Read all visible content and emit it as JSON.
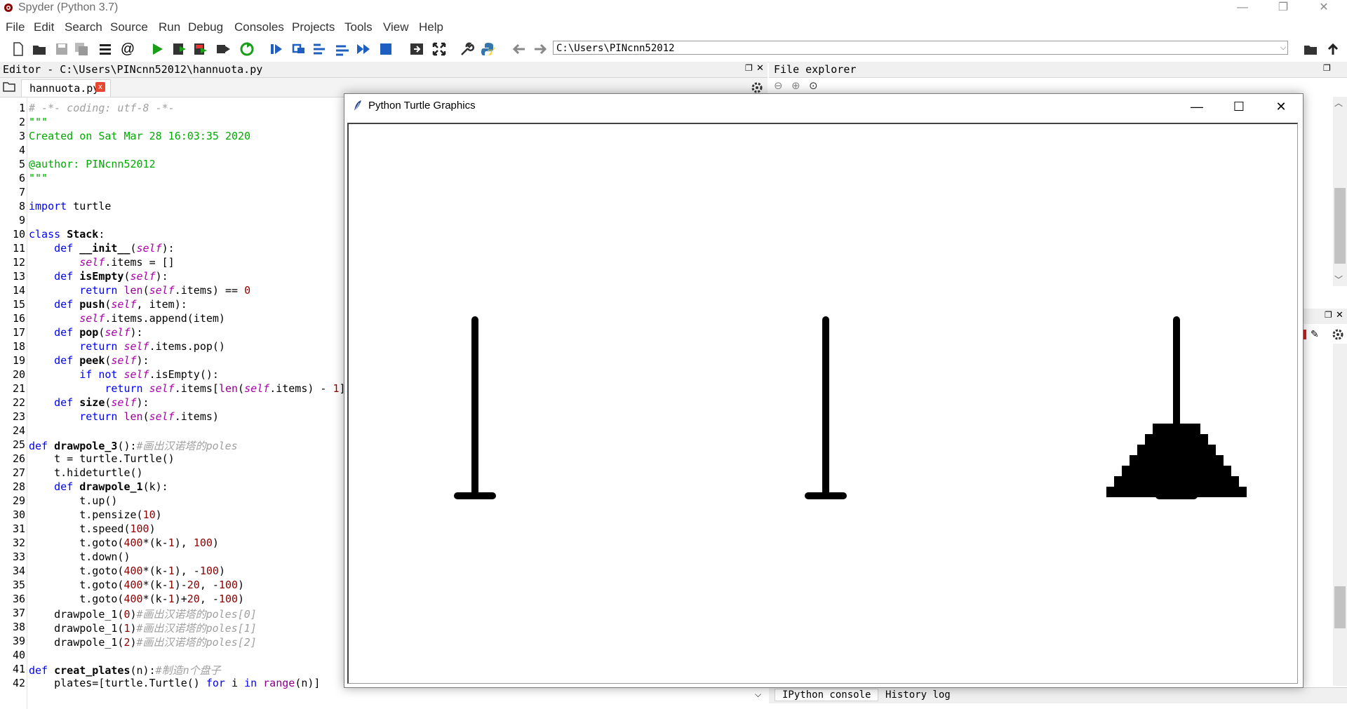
{
  "app": {
    "title": "Spyder (Python 3.7)"
  },
  "window_controls": {
    "minimize": "—",
    "restore": "❐",
    "close": "✕"
  },
  "menu": [
    "File",
    "Edit",
    "Search",
    "Source",
    "Run",
    "Debug",
    "Consoles",
    "Projects",
    "Tools",
    "View",
    "Help"
  ],
  "toolbar": {
    "path": "C:\\Users\\PINcnn52012"
  },
  "editor": {
    "header": "Editor - C:\\Users\\PINcnn52012\\hannuota.py",
    "tab_label": "hannuota.py",
    "tab_close": "x"
  },
  "code_lines": [
    {
      "n": "1",
      "html": "<span class='cm'># -*- coding: utf-8 -*-</span>"
    },
    {
      "n": "2",
      "html": "<span class='st'>\"\"\"</span>"
    },
    {
      "n": "3",
      "html": "<span class='st'>Created on Sat Mar 28 16:03:35 2020</span>"
    },
    {
      "n": "4",
      "html": ""
    },
    {
      "n": "5",
      "html": "<span class='st'>@author: PINcnn52012</span>"
    },
    {
      "n": "6",
      "html": "<span class='st'>\"\"\"</span>"
    },
    {
      "n": "7",
      "html": ""
    },
    {
      "n": "8",
      "html": "<span class='kw'>import</span> turtle"
    },
    {
      "n": "9",
      "html": ""
    },
    {
      "n": "10",
      "html": "<span class='kw'>class</span> <span class='fn'>Stack</span>:"
    },
    {
      "n": "11",
      "html": "    <span class='kw'>def</span> <span class='fn'>__init__</span>(<span class='sf'>self</span>):"
    },
    {
      "n": "12",
      "html": "        <span class='sf'>self</span>.items = []"
    },
    {
      "n": "13",
      "html": "    <span class='kw'>def</span> <span class='fn'>isEmpty</span>(<span class='sf'>self</span>):"
    },
    {
      "n": "14",
      "html": "        <span class='kw'>return</span> <span class='bi'>len</span>(<span class='sf'>self</span>.items) == <span class='nm'>0</span>"
    },
    {
      "n": "15",
      "html": "    <span class='kw'>def</span> <span class='fn'>push</span>(<span class='sf'>self</span>, item):"
    },
    {
      "n": "16",
      "html": "        <span class='sf'>self</span>.items.append(item)"
    },
    {
      "n": "17",
      "html": "    <span class='kw'>def</span> <span class='fn'>pop</span>(<span class='sf'>self</span>):"
    },
    {
      "n": "18",
      "html": "        <span class='kw'>return</span> <span class='sf'>self</span>.items.pop()"
    },
    {
      "n": "19",
      "html": "    <span class='kw'>def</span> <span class='fn'>peek</span>(<span class='sf'>self</span>):"
    },
    {
      "n": "20",
      "html": "        <span class='kw'>if not</span> <span class='sf'>self</span>.isEmpty():"
    },
    {
      "n": "21",
      "html": "            <span class='kw'>return</span> <span class='sf'>self</span>.items[<span class='bi'>len</span>(<span class='sf'>self</span>.items) - <span class='nm'>1</span>]"
    },
    {
      "n": "22",
      "html": "    <span class='kw'>def</span> <span class='fn'>size</span>(<span class='sf'>self</span>):"
    },
    {
      "n": "23",
      "html": "        <span class='kw'>return</span> <span class='bi'>len</span>(<span class='sf'>self</span>.items)"
    },
    {
      "n": "24",
      "html": ""
    },
    {
      "n": "25",
      "html": "<span class='kw'>def</span> <span class='fn'>drawpole_3</span>():<span class='cm'>#画出汉诺塔的poles</span>"
    },
    {
      "n": "26",
      "html": "    t = turtle.Turtle()"
    },
    {
      "n": "27",
      "html": "    t.hideturtle()"
    },
    {
      "n": "28",
      "html": "    <span class='kw'>def</span> <span class='fn'>drawpole_1</span>(k):"
    },
    {
      "n": "29",
      "html": "        t.up()"
    },
    {
      "n": "30",
      "html": "        t.pensize(<span class='nm'>10</span>)"
    },
    {
      "n": "31",
      "html": "        t.speed(<span class='nm'>100</span>)"
    },
    {
      "n": "32",
      "html": "        t.goto(<span class='nm'>400</span>*(k-<span class='nm'>1</span>), <span class='nm'>100</span>)"
    },
    {
      "n": "33",
      "html": "        t.down()"
    },
    {
      "n": "34",
      "html": "        t.goto(<span class='nm'>400</span>*(k-<span class='nm'>1</span>), -<span class='nm'>100</span>)"
    },
    {
      "n": "35",
      "html": "        t.goto(<span class='nm'>400</span>*(k-<span class='nm'>1</span>)-<span class='nm'>20</span>, -<span class='nm'>100</span>)"
    },
    {
      "n": "36",
      "html": "        t.goto(<span class='nm'>400</span>*(k-<span class='nm'>1</span>)+<span class='nm'>20</span>, -<span class='nm'>100</span>)"
    },
    {
      "n": "37",
      "html": "    drawpole_1(<span class='nm'>0</span>)<span class='cm'>#画出汉诺塔的poles[0]</span>"
    },
    {
      "n": "38",
      "html": "    drawpole_1(<span class='nm'>1</span>)<span class='cm'>#画出汉诺塔的poles[1]</span>"
    },
    {
      "n": "39",
      "html": "    drawpole_1(<span class='nm'>2</span>)<span class='cm'>#画出汉诺塔的poles[2]</span>"
    },
    {
      "n": "40",
      "html": ""
    },
    {
      "n": "41",
      "html": "<span class='kw'>def</span> <span class='fn'>creat_plates</span>(n):<span class='cm'>#制造n个盘子</span>"
    },
    {
      "n": "42",
      "html": "    plates=[turtle.Turtle() <span class='kw'>for</span> i <span class='kw'>in</span> <span class='bi'>range</span>(n)]"
    }
  ],
  "file_explorer": {
    "title": "File explorer"
  },
  "console_tabs": [
    "IPython console",
    "History log"
  ],
  "turtle_window": {
    "title": "Python Turtle Graphics",
    "minimize": "—",
    "maximize": "☐",
    "close": "✕",
    "plates_on_pole_3": 7
  },
  "colors": {
    "keyword": "#0000ff",
    "string": "#00aa00",
    "comment": "#a0a0a0",
    "self": "#aa00aa",
    "number": "#8b0000",
    "run_green": "#1a9e1a",
    "stop_blue": "#1f5fbf",
    "tab_close_red": "#e8482f"
  }
}
